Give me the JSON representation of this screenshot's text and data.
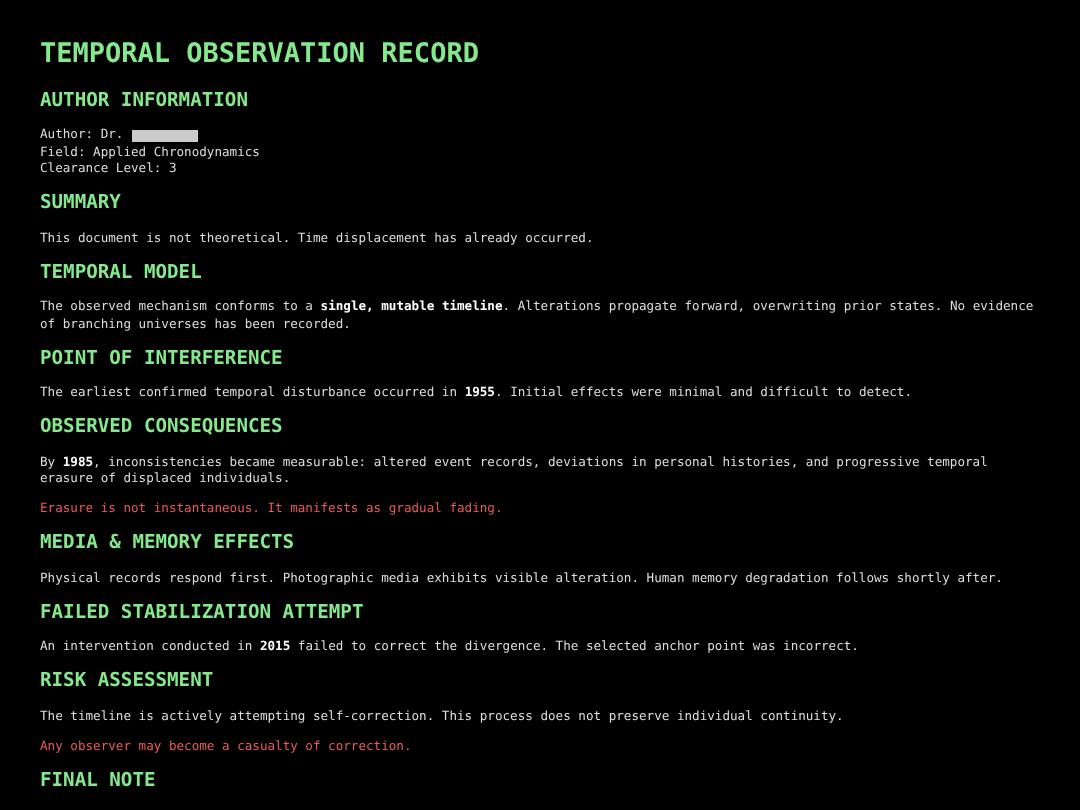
{
  "title": "TEMPORAL OBSERVATION RECORD",
  "sections": [
    {
      "heading": "AUTHOR INFORMATION",
      "author": {
        "label": "Author: Dr.",
        "redacted": true
      },
      "lines": [
        "Field: Applied Chronodynamics",
        "Clearance Level: 3"
      ]
    },
    {
      "heading": "SUMMARY",
      "paragraphs": [
        {
          "kind": "text",
          "text": "This document is not theoretical. Time displacement has already occurred."
        }
      ]
    },
    {
      "heading": "TEMPORAL MODEL",
      "paragraphs": [
        {
          "kind": "text",
          "text": "The observed mechanism conforms to a **single, mutable timeline**. Alterations propagate forward, overwriting prior states. No evidence of branching universes has been recorded."
        }
      ]
    },
    {
      "heading": "POINT OF INTERFERENCE",
      "paragraphs": [
        {
          "kind": "text",
          "text": "The earliest confirmed temporal disturbance occurred in **1955**. Initial effects were minimal and difficult to detect."
        }
      ]
    },
    {
      "heading": "OBSERVED CONSEQUENCES",
      "paragraphs": [
        {
          "kind": "text",
          "text": "By **1985**, inconsistencies became measurable: altered event records, deviations in personal histories, and progressive temporal erasure of displaced individuals."
        },
        {
          "kind": "warning",
          "text": "Erasure is not instantaneous. It manifests as gradual fading."
        }
      ]
    },
    {
      "heading": "MEDIA & MEMORY EFFECTS",
      "paragraphs": [
        {
          "kind": "text",
          "text": "Physical records respond first. Photographic media exhibits visible alteration. Human memory degradation follows shortly after."
        }
      ]
    },
    {
      "heading": "FAILED STABILIZATION ATTEMPT",
      "paragraphs": [
        {
          "kind": "text",
          "text": "An intervention conducted in **2015** failed to correct the divergence. The selected anchor point was incorrect."
        }
      ]
    },
    {
      "heading": "RISK ASSESSMENT",
      "paragraphs": [
        {
          "kind": "text",
          "text": "The timeline is actively attempting self-correction. This process does not preserve individual continuity."
        },
        {
          "kind": "warning",
          "text": "Any observer may become a casualty of correction."
        }
      ]
    },
    {
      "heading": "FINAL NOTE"
    }
  ]
}
